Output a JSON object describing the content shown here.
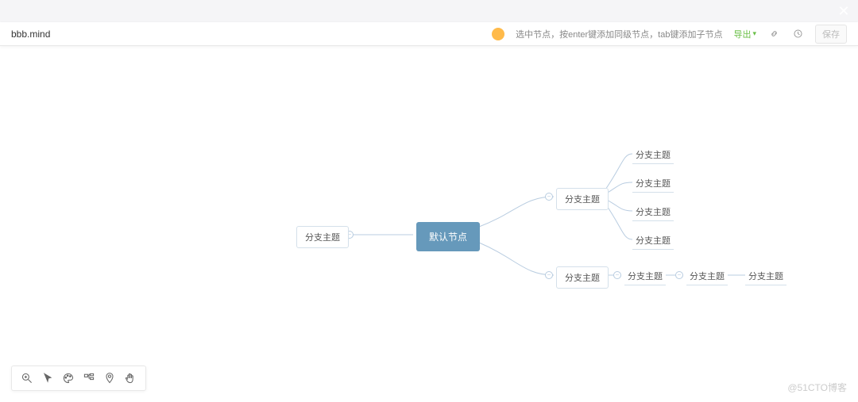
{
  "header": {
    "filename": "bbb.mind",
    "hint": "选中节点，按enter键添加同级节点，tab键添加子节点",
    "export_label": "导出",
    "save_label": "保存"
  },
  "mindmap": {
    "root": {
      "label": "默认节点"
    },
    "left": {
      "label": "分支主题"
    },
    "topBranch": {
      "label": "分支主题",
      "children": [
        {
          "label": "分支主题"
        },
        {
          "label": "分支主题"
        },
        {
          "label": "分支主题"
        },
        {
          "label": "分支主题"
        }
      ]
    },
    "bottomBranch": {
      "label": "分支主题",
      "chain": [
        {
          "label": "分支主题"
        },
        {
          "label": "分支主题"
        },
        {
          "label": "分支主题"
        }
      ]
    }
  },
  "colors": {
    "rootBg": "#6699bb",
    "connector": "#b8cce0"
  },
  "watermark": "@51CTO博客"
}
